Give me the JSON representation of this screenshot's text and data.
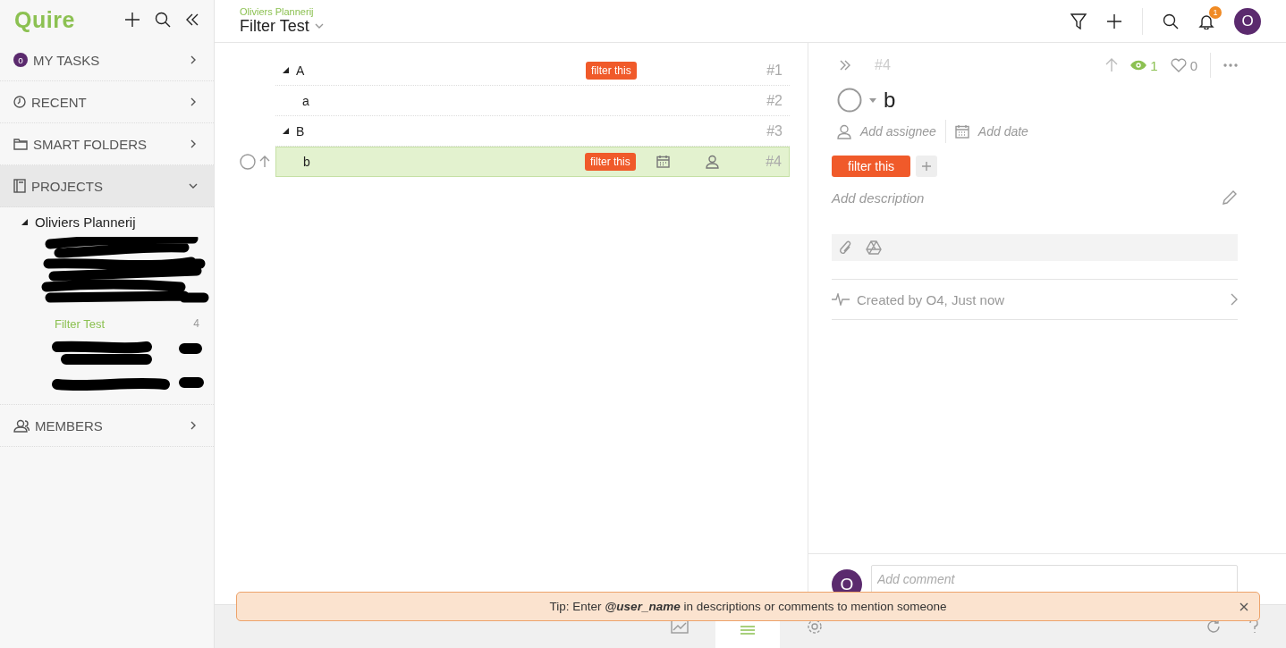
{
  "sidebar": {
    "logo": "Quire",
    "nav": [
      {
        "kind": "avatar",
        "avatar": "o",
        "label": "MY TASKS",
        "expanded": false,
        "selected": false
      },
      {
        "kind": "clock",
        "label": "RECENT",
        "expanded": false,
        "selected": false
      },
      {
        "kind": "folder",
        "label": "SMART FOLDERS",
        "expanded": false,
        "selected": false
      },
      {
        "kind": "notebook",
        "label": "PROJECTS",
        "expanded": true,
        "selected": true,
        "children": [
          {
            "label": "Oliviers Plannerij",
            "expanded": true,
            "children": [
              {
                "label": "Filter Test",
                "count": "4",
                "selected": true
              }
            ]
          }
        ]
      },
      {
        "kind": "members",
        "label": "MEMBERS",
        "expanded": false,
        "selected": false
      }
    ]
  },
  "header": {
    "breadcrumb": "Oliviers Plannerij",
    "title": "Filter Test",
    "notification_count": "1",
    "avatar": "O"
  },
  "tasks": [
    {
      "title": "A",
      "number": "#1",
      "tag": "filter this",
      "expanded": true,
      "selected": false,
      "children": [
        {
          "title": "a",
          "number": "#2",
          "selected": false
        }
      ]
    },
    {
      "title": "B",
      "number": "#3",
      "expanded": true,
      "selected": false,
      "children": [
        {
          "title": "b",
          "number": "#4",
          "tag": "filter this",
          "selected": true
        }
      ]
    }
  ],
  "detail": {
    "number": "#4",
    "watchers": "1",
    "likes": "0",
    "title": "b",
    "assignee": "Add assignee",
    "date": "Add date",
    "tags": [
      "filter this"
    ],
    "description_placeholder": "Add description",
    "activity": "Created by O4, Just now",
    "comment_avatar": "O",
    "comment_placeholder": "Add comment"
  },
  "tip": {
    "text": "Tip: Enter **@user_name** in descriptions or comments to mention someone"
  }
}
